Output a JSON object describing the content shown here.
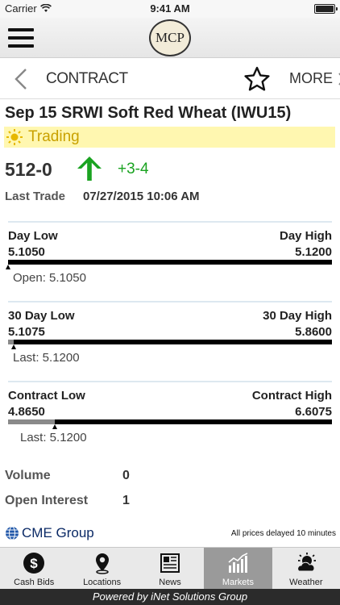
{
  "status_bar": {
    "carrier": "Carrier",
    "time": "9:41 AM"
  },
  "header": {
    "logo_text": "MCP"
  },
  "sub_nav": {
    "title": "CONTRACT",
    "more_label": "MORE"
  },
  "contract": {
    "title": "Sep 15 SRWI Soft Red Wheat (IWU15)",
    "status": "Trading",
    "price": "512-0",
    "change": "+3-4",
    "change_color": "#1aa321",
    "last_trade_label": "Last Trade",
    "last_trade_value": "07/27/2015 10:06 AM"
  },
  "ranges": [
    {
      "low_label": "Day Low",
      "high_label": "Day High",
      "low": "5.1050",
      "high": "5.1200",
      "marker_text": "Open: 5.1050",
      "position": 0.0
    },
    {
      "low_label": "30 Day Low",
      "high_label": "30 Day High",
      "low": "5.1075",
      "high": "5.8600",
      "marker_text": "Last: 5.1200",
      "position": 0.017
    },
    {
      "low_label": "Contract Low",
      "high_label": "Contract High",
      "low": "4.8650",
      "high": "6.6075",
      "marker_text": "Last: 5.1200",
      "position": 0.145
    }
  ],
  "stats": {
    "volume_label": "Volume",
    "volume": "0",
    "open_interest_label": "Open Interest",
    "open_interest": "1"
  },
  "footer_info": {
    "brand": "CME Group",
    "delay_note": "All prices delayed 10 minutes"
  },
  "tabs": [
    {
      "label": "Cash Bids",
      "icon": "dollar-icon",
      "active": false
    },
    {
      "label": "Locations",
      "icon": "location-pin-icon",
      "active": false
    },
    {
      "label": "News",
      "icon": "newspaper-icon",
      "active": false
    },
    {
      "label": "Markets",
      "icon": "bar-chart-icon",
      "active": true
    },
    {
      "label": "Weather",
      "icon": "weather-icon",
      "active": false
    }
  ],
  "powered_by": "Powered by iNet Solutions Group"
}
